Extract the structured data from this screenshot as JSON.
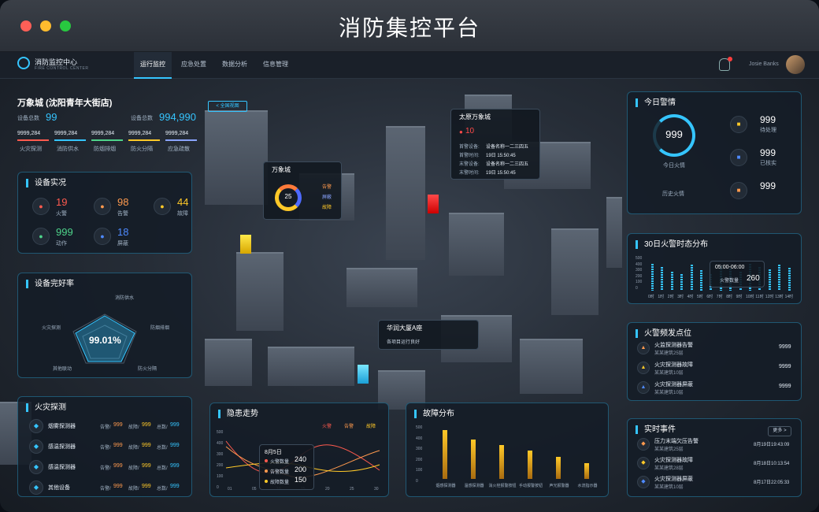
{
  "window": {
    "title": "消防集控平台"
  },
  "nav": {
    "brand": "消防监控中心",
    "brand_sub": "FIRE CONTROL CENTER",
    "tabs": [
      "运行监控",
      "应急处置",
      "数据分析",
      "信息管理"
    ],
    "user": "Josie Banks"
  },
  "site": {
    "name": "万象城 (沈阳青年大街店)",
    "devices_label": "设备总数",
    "devices_count": "99",
    "devices_label2": "设备总数",
    "devices_total": "994,990",
    "return_btn": "< 全国视图",
    "stats": [
      {
        "v": "9999,284",
        "l": "火灾探测"
      },
      {
        "v": "9999,284",
        "l": "消防供水"
      },
      {
        "v": "9999,284",
        "l": "防烟排烟"
      },
      {
        "v": "9999,284",
        "l": "防火分隔"
      },
      {
        "v": "9999,284",
        "l": "应急疏散"
      }
    ]
  },
  "equip": {
    "title": "设备实况",
    "items": [
      {
        "v": "19",
        "l": "火警",
        "c": "#ff5a4e"
      },
      {
        "v": "98",
        "l": "告警",
        "c": "#ff9a4e"
      },
      {
        "v": "44",
        "l": "故障",
        "c": "#ffc928"
      },
      {
        "v": "999",
        "l": "动作",
        "c": "#4ed38a"
      },
      {
        "v": "18",
        "l": "屏蔽",
        "c": "#4e8aff"
      }
    ]
  },
  "rate": {
    "title": "设备完好率",
    "value": "99.01%",
    "axes": [
      "消防供水",
      "防烟排烟",
      "防火分隔",
      "其他联动",
      "火灾探测"
    ],
    "ticks": [
      "600",
      "500",
      "400",
      "300",
      "200",
      "100"
    ]
  },
  "detect": {
    "title": "火灾探测",
    "rows": [
      {
        "name": "烟雾探测器",
        "a": "告警/",
        "av": "999",
        "b": "故障/",
        "bv": "999",
        "c": "总数/",
        "cv": "999"
      },
      {
        "name": "感温探测器",
        "a": "告警/",
        "av": "999",
        "b": "故障/",
        "bv": "999",
        "c": "总数/",
        "cv": "999"
      },
      {
        "name": "感温探测器",
        "a": "告警/",
        "av": "999",
        "b": "故障/",
        "bv": "999",
        "c": "总数/",
        "cv": "999"
      },
      {
        "name": "其他设备",
        "a": "告警/",
        "av": "999",
        "b": "故障/",
        "bv": "999",
        "c": "总数/",
        "cv": "999"
      }
    ]
  },
  "hazard": {
    "title": "隐患走势",
    "legend": [
      "火警",
      "告警",
      "故障"
    ],
    "yticks": [
      "500",
      "400",
      "300",
      "200",
      "100",
      "0"
    ],
    "xticks": [
      "01",
      "05",
      "10",
      "15",
      "20",
      "25",
      "30"
    ],
    "tip_date": "8月5日",
    "tip": [
      {
        "l": "火警数量",
        "v": "240"
      },
      {
        "l": "告警数量",
        "v": "200"
      },
      {
        "l": "故障数量",
        "v": "150"
      }
    ]
  },
  "fault": {
    "title": "故障分布",
    "yticks": [
      "500",
      "400",
      "300",
      "200",
      "100",
      "0"
    ],
    "cats": [
      "烟感探测器",
      "温感探测器",
      "消火栓报警按钮",
      "手动报警按钮",
      "声光报警器",
      "水流指示器"
    ],
    "values": [
      440,
      360,
      310,
      260,
      200,
      140
    ]
  },
  "today": {
    "title": "今日警情",
    "ring_value": "999",
    "ring_label": "今日火情",
    "history_label": "历史火情",
    "items": [
      {
        "v": "999",
        "l": "待处理"
      },
      {
        "v": "999",
        "l": "已核实"
      },
      {
        "v": "999",
        "l": ""
      }
    ]
  },
  "month": {
    "title": "30日火警时态分布",
    "yticks": [
      "500",
      "400",
      "300",
      "200",
      "100",
      "0"
    ],
    "xticks": [
      "0时",
      "1时",
      "2时",
      "3时",
      "4时",
      "5时",
      "6时",
      "7时",
      "8时",
      "9时",
      "10时",
      "11时",
      "12时",
      "13时",
      "14时"
    ],
    "tip_time": "05:00-06:00",
    "tip_label": "火警数量",
    "tip_value": "260"
  },
  "freq": {
    "title": "火警频发点位",
    "rows": [
      {
        "t": "火监探测器告警",
        "s": "某某建筑25层",
        "v": "9999"
      },
      {
        "t": "火灾探测器故障",
        "s": "某某建筑10层",
        "v": "9999"
      },
      {
        "t": "火灾探测器屏蔽",
        "s": "某某建筑10层",
        "v": "9999"
      }
    ]
  },
  "events": {
    "title": "实时事件",
    "more": "更多 >",
    "rows": [
      {
        "t": "压力末端欠压告警",
        "s": "某某建筑25层",
        "d": "8月19日19:43:09"
      },
      {
        "t": "火灾探测器故障",
        "s": "某某建筑28层",
        "d": "8月18日10:13:54"
      },
      {
        "t": "火灾探测器屏蔽",
        "s": "某某建筑10层",
        "d": "8月17日22:05:33"
      }
    ]
  },
  "pop_taiyuan": {
    "name": "太原万象城",
    "count": "10",
    "rows": [
      [
        "首警设备:",
        "设备名称一二三四五"
      ],
      [
        "首警时间:",
        "19日 15:50:45"
      ],
      [
        "末警设备:",
        "设备名称一二三四五"
      ],
      [
        "末警时间:",
        "19日 15:50:45"
      ]
    ]
  },
  "pop_wanxiang": {
    "name": "万象城",
    "value": "25",
    "legend": [
      "告警",
      "屏蔽",
      "故障"
    ]
  },
  "pop_huarun": {
    "name": "华润大厦A座",
    "status": "各项目运行良好"
  }
}
